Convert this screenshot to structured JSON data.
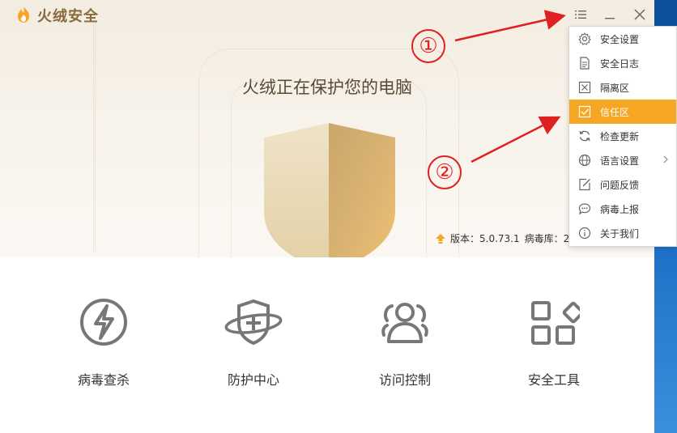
{
  "app": {
    "name": "火绒安全",
    "brand_color": "#f5a623"
  },
  "titlebar": {
    "menu_icon": "menu-list-icon",
    "minimize_icon": "minimize-icon",
    "close_icon": "close-icon"
  },
  "hero": {
    "title": "火绒正在保护您的电脑",
    "version_text": "版本：5.0.73.1",
    "virus_db_text": "病毒库：2"
  },
  "tiles": [
    {
      "label": "病毒查杀",
      "icon": "lightning-scan-icon"
    },
    {
      "label": "防护中心",
      "icon": "shield-plus-icon"
    },
    {
      "label": "访问控制",
      "icon": "users-icon"
    },
    {
      "label": "安全工具",
      "icon": "tools-grid-icon"
    }
  ],
  "menu": {
    "items": [
      {
        "label": "安全设置",
        "icon": "gear-icon"
      },
      {
        "label": "安全日志",
        "icon": "log-icon"
      },
      {
        "label": "隔离区",
        "icon": "quarantine-icon"
      },
      {
        "label": "信任区",
        "icon": "trust-check-icon",
        "active": true
      },
      {
        "label": "检查更新",
        "icon": "refresh-icon"
      },
      {
        "label": "语言设置",
        "icon": "globe-icon",
        "has_submenu": true
      },
      {
        "label": "问题反馈",
        "icon": "edit-icon"
      },
      {
        "label": "病毒上报",
        "icon": "chat-icon"
      },
      {
        "label": "关于我们",
        "icon": "info-icon"
      }
    ]
  },
  "annotations": {
    "one": "①",
    "two": "②",
    "color": "#e02020"
  }
}
